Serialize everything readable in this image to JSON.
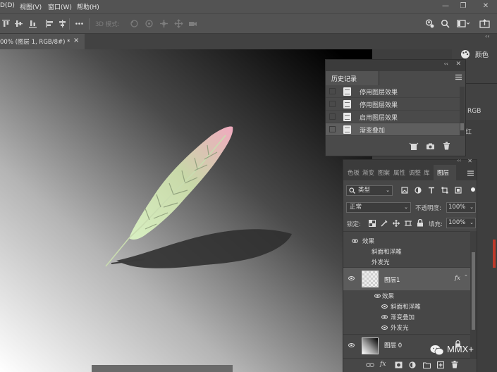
{
  "menubar": {
    "items": [
      "D(D)",
      "视图(V)",
      "窗口(W)",
      "帮助(H)"
    ]
  },
  "options_bar": {
    "mode_3d_label": "3D 模式:"
  },
  "document_tab": {
    "title": "00% (图层 1, RGB/8#) *",
    "close": "×"
  },
  "color_panel": {
    "title": "颜色",
    "rgb_label": "RGB",
    "hint": "红"
  },
  "history_panel": {
    "title": "历史记录",
    "items": [
      {
        "label": "停用图层效果"
      },
      {
        "label": "停用图层效果"
      },
      {
        "label": "启用图层效果"
      },
      {
        "label": "渐变叠加"
      }
    ]
  },
  "layers_panel": {
    "tabs": [
      "色板",
      "渐变",
      "图案",
      "属性",
      "调整",
      "库",
      "图层"
    ],
    "active_tab": "图层",
    "filter_label": "类型",
    "blend_mode": "正常",
    "opacity_label": "不透明度:",
    "opacity_value": "100%",
    "lock_label": "锁定:",
    "fill_label": "填充:",
    "fill_value": "100%",
    "top_group": {
      "effects_label": "效果",
      "effects": [
        "斜面和浮雕",
        "外发光"
      ]
    },
    "layers": [
      {
        "name": "图层1",
        "fx": "fx",
        "effects_label": "效果",
        "effects": [
          "斜面和浮雕",
          "渐变叠加",
          "外发光"
        ]
      },
      {
        "name": "图层 0"
      }
    ],
    "bottom_fx": "fx"
  },
  "watermark": "MMX+"
}
